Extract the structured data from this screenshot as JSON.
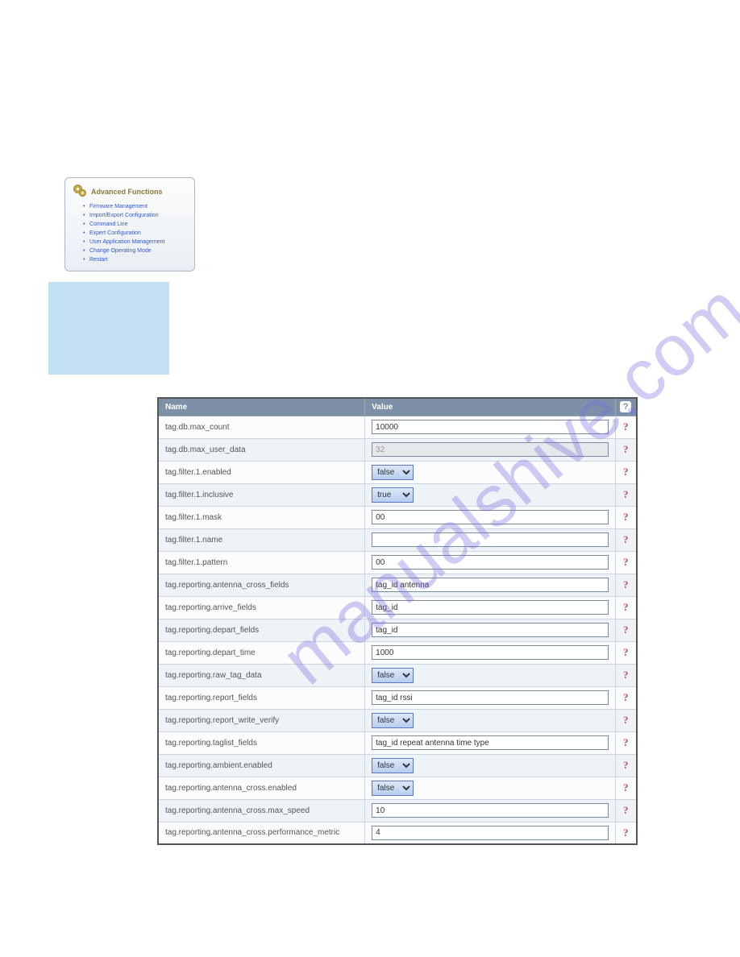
{
  "watermark": "manualshive.com",
  "sidebar": {
    "title": "Advanced Functions",
    "items": [
      "Firmware Management",
      "Import/Export Configuration",
      "Command Line",
      "Expert Configuration",
      "User Application Management",
      "Change Operating Mode",
      "Restart"
    ]
  },
  "table": {
    "header_name": "Name",
    "header_value": "Value",
    "header_help": "?",
    "rows": [
      {
        "name": "tag.db.max_count",
        "type": "text",
        "value": "10000"
      },
      {
        "name": "tag.db.max_user_data",
        "type": "text",
        "value": "32",
        "disabled": true
      },
      {
        "name": "tag.filter.1.enabled",
        "type": "select",
        "value": "false"
      },
      {
        "name": "tag.filter.1.inclusive",
        "type": "select",
        "value": "true"
      },
      {
        "name": "tag.filter.1.mask",
        "type": "text",
        "value": "00"
      },
      {
        "name": "tag.filter.1.name",
        "type": "text",
        "value": ""
      },
      {
        "name": "tag.filter.1.pattern",
        "type": "text",
        "value": "00"
      },
      {
        "name": "tag.reporting.antenna_cross_fields",
        "type": "text",
        "value": "tag_id antenna"
      },
      {
        "name": "tag.reporting.arrive_fields",
        "type": "text",
        "value": "tag_id"
      },
      {
        "name": "tag.reporting.depart_fields",
        "type": "text",
        "value": "tag_id"
      },
      {
        "name": "tag.reporting.depart_time",
        "type": "text",
        "value": "1000"
      },
      {
        "name": "tag.reporting.raw_tag_data",
        "type": "select",
        "value": "false"
      },
      {
        "name": "tag.reporting.report_fields",
        "type": "text",
        "value": "tag_id rssi"
      },
      {
        "name": "tag.reporting.report_write_verify",
        "type": "select",
        "value": "false"
      },
      {
        "name": "tag.reporting.taglist_fields",
        "type": "text",
        "value": "tag_id repeat antenna time type"
      },
      {
        "name": "tag.reporting.ambient.enabled",
        "type": "select",
        "value": "false"
      },
      {
        "name": "tag.reporting.antenna_cross.enabled",
        "type": "select",
        "value": "false"
      },
      {
        "name": "tag.reporting.antenna_cross.max_speed",
        "type": "text",
        "value": "10"
      },
      {
        "name": "tag.reporting.antenna_cross.performance_metric",
        "type": "text",
        "value": "4"
      }
    ],
    "help": "?"
  }
}
